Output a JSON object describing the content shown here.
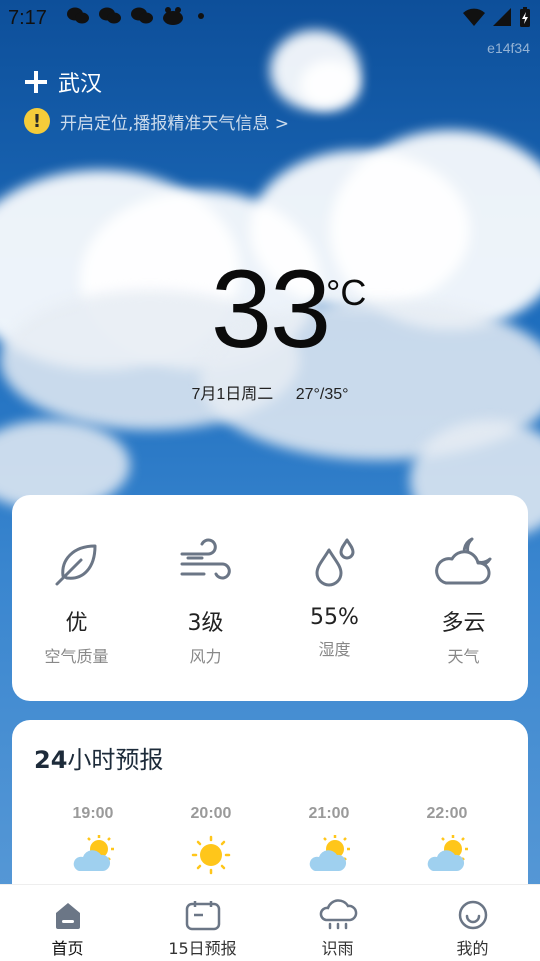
{
  "status_bar": {
    "time": "7:17",
    "left_icons": [
      "wechat-icon",
      "wechat-icon",
      "wechat-icon",
      "app-icon",
      "dot-icon"
    ],
    "right_icons": [
      "wifi-icon",
      "signal-icon",
      "battery-charging-icon"
    ]
  },
  "build_id": "e14f34",
  "header": {
    "add_icon": "plus-icon",
    "city": "武汉",
    "location_hint": "开启定位,播报精准天气信息 >"
  },
  "current": {
    "temperature": "33",
    "unit": "°C",
    "date": "7月1日周二",
    "range": "27°/35°"
  },
  "stats": [
    {
      "icon": "leaf-icon",
      "value": "优",
      "label": "空气质量"
    },
    {
      "icon": "wind-icon",
      "value": "3级",
      "label": "风力"
    },
    {
      "icon": "humidity-icon",
      "value": "55%",
      "label": "湿度"
    },
    {
      "icon": "cloudy-moon-icon",
      "value": "多云",
      "label": "天气"
    }
  ],
  "hourly": {
    "title_num": "24",
    "title_text": "小时预报",
    "items": [
      {
        "time": "19:00",
        "icon": "partly-cloudy-icon"
      },
      {
        "time": "20:00",
        "icon": "sun-icon"
      },
      {
        "time": "21:00",
        "icon": "partly-cloudy-icon"
      },
      {
        "time": "22:00",
        "icon": "partly-cloudy-icon"
      }
    ]
  },
  "nav": [
    {
      "label": "首页",
      "icon": "home-icon",
      "active": true
    },
    {
      "label": "15日预报",
      "icon": "calendar-icon",
      "active": false
    },
    {
      "label": "识雨",
      "icon": "rain-icon",
      "active": false
    },
    {
      "label": "我的",
      "icon": "profile-icon",
      "active": false
    }
  ],
  "colors": {
    "sky_top": "#0d4f9a",
    "sky_bottom": "#5b9bd7",
    "warning": "#f5cc3a",
    "icon_stroke": "#6b7686",
    "sun": "#ffc61a"
  }
}
